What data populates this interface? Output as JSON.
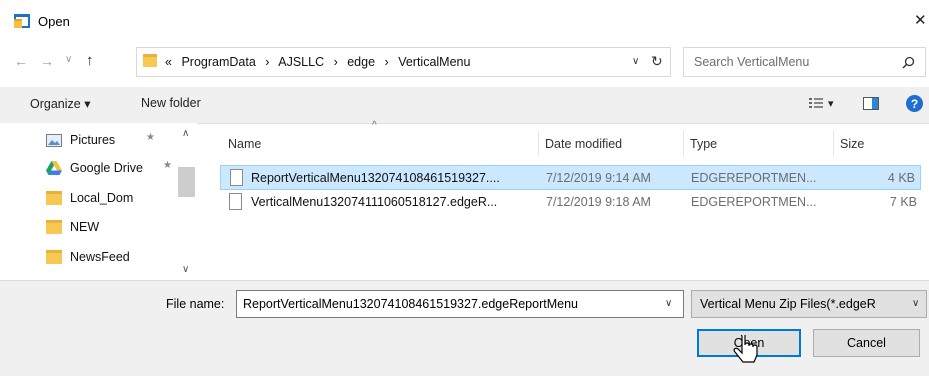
{
  "window": {
    "title": "Open"
  },
  "address": {
    "breadcrumb": [
      {
        "label": "«"
      },
      {
        "label": "ProgramData"
      },
      {
        "label": "AJSLLC"
      },
      {
        "label": "edge"
      },
      {
        "label": "VerticalMenu"
      }
    ],
    "separator": "›",
    "search_placeholder": "Search VerticalMenu"
  },
  "toolbar": {
    "organize": "Organize ▾",
    "new_folder": "New folder",
    "view_dropdown": "▾"
  },
  "nav": {
    "items": [
      {
        "label": "Pictures",
        "icon": "pictures-icon",
        "pinned": true
      },
      {
        "label": "Google Drive",
        "icon": "google-drive-icon",
        "pinned": true
      },
      {
        "label": "Local_Dom",
        "icon": "folder-icon"
      },
      {
        "label": "NEW",
        "icon": "folder-icon"
      },
      {
        "label": "NewsFeed",
        "icon": "folder-icon"
      }
    ]
  },
  "columns": {
    "name": "Name",
    "date": "Date modified",
    "type": "Type",
    "size": "Size",
    "sort_glyph": "^"
  },
  "files": [
    {
      "name": "ReportVerticalMenu132074108461519327....",
      "date": "7/12/2019 9:14 AM",
      "type": "EDGEREPORTMEN...",
      "size": "4 KB",
      "selected": true
    },
    {
      "name": "VerticalMenu132074111060518127.edgeR...",
      "date": "7/12/2019 9:18 AM",
      "type": "EDGEREPORTMEN...",
      "size": "7 KB",
      "selected": false
    }
  ],
  "footer": {
    "filename_label": "File name:",
    "filename_value": "ReportVerticalMenu132074108461519327.edgeReportMenu",
    "filter_value": "Vertical Menu Zip Files(*.edgeR",
    "open_label": "Open",
    "cancel_label": "Cancel"
  },
  "colors": {
    "selection": "#cce8ff",
    "selection_border": "#99d1ff",
    "accent": "#0078d7"
  }
}
